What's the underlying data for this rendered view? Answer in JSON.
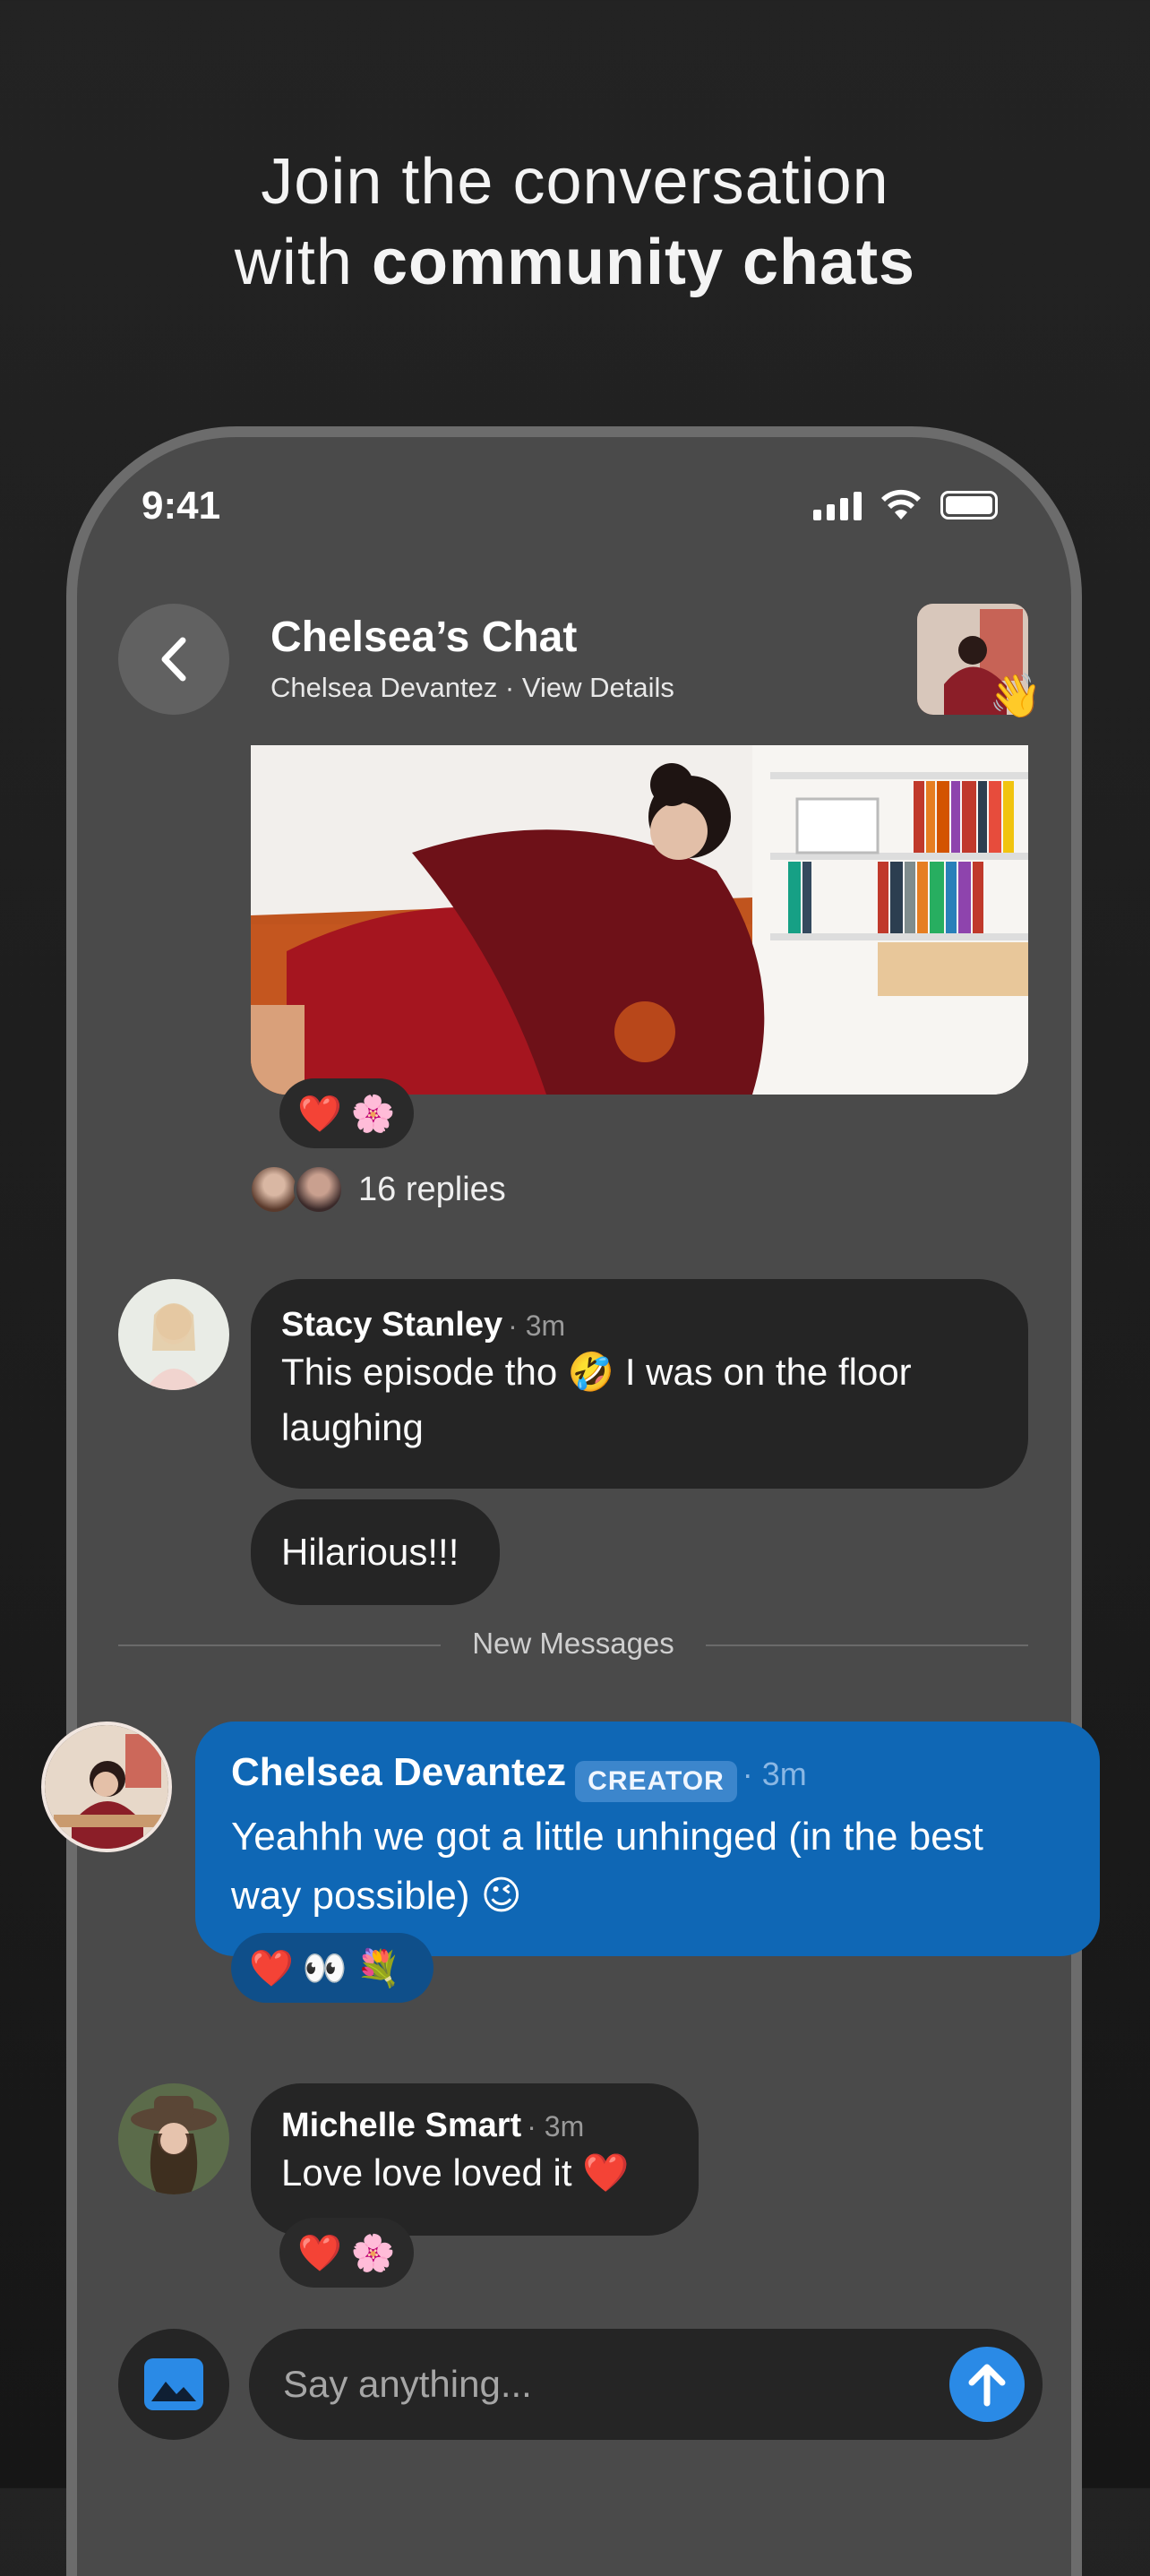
{
  "headline": {
    "line1": "Join the conversation",
    "line2_prefix": "with ",
    "line2_bold": "community chats"
  },
  "status_bar": {
    "time": "9:41"
  },
  "header": {
    "title": "Chelsea’s Chat",
    "subtitle": "Chelsea Devantez · View Details",
    "wave_emoji": "👋"
  },
  "post": {
    "reactions": [
      "❤️",
      "🌸"
    ],
    "replies_label": "16 replies"
  },
  "messages": [
    {
      "author": "Stacy Stanley",
      "time": "· 3m",
      "text": "This episode tho 🤣 I was on the floor laughing",
      "followup": "Hilarious!!!"
    }
  ],
  "divider": {
    "label": "New Messages"
  },
  "creator_message": {
    "author": "Chelsea Devantez",
    "badge": "CREATOR",
    "time": "· 3m",
    "text": "Yeahhh we got a little unhinged (in the best way possible) 😉",
    "reactions": [
      "❤️",
      "👀",
      "💐"
    ]
  },
  "message2": {
    "author": "Michelle Smart",
    "time": "· 3m",
    "text": "Love love loved it ❤️",
    "reactions": [
      "❤️",
      "🌸"
    ]
  },
  "composer": {
    "placeholder": "Say anything..."
  },
  "colors": {
    "creator_bubble": "#0f67b5",
    "send_button": "#2a8ae6",
    "bubble": "#252525",
    "phone_bg": "#4a4a4a"
  },
  "icons": {
    "back": "chevron-left-icon",
    "image": "image-icon",
    "send": "arrow-up-icon"
  }
}
